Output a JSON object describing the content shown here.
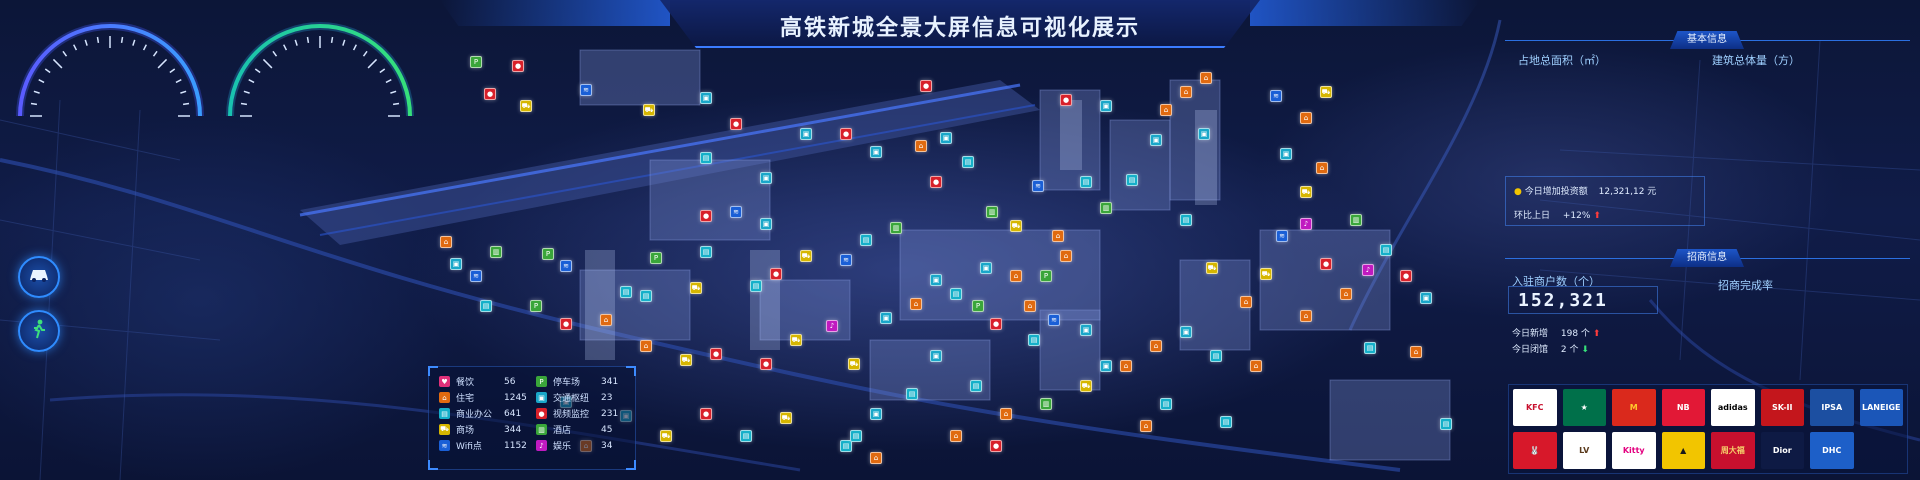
{
  "title": "高铁新城全景大屏信息可视化展示",
  "gauges": [
    {
      "name": "gauge-left",
      "accent": "#5b7bff",
      "accent2": "#3a9dff"
    },
    {
      "name": "gauge-right",
      "accent": "#2bd3a0",
      "accent2": "#22c1e8"
    }
  ],
  "side_buttons": [
    {
      "name": "car-button",
      "icon": "car-icon",
      "glyph": "🚘"
    },
    {
      "name": "walk-button",
      "icon": "walk-icon",
      "glyph": "🏃"
    }
  ],
  "legend": {
    "items": [
      {
        "label": "餐饮",
        "value": "56",
        "color": "#e0307a",
        "icon": "food-icon",
        "glyph": "♥"
      },
      {
        "label": "停车场",
        "value": "341",
        "color": "#3aa63a",
        "icon": "parking-icon",
        "glyph": "P"
      },
      {
        "label": "住宅",
        "value": "1245",
        "color": "#e06a10",
        "icon": "house-icon",
        "glyph": "⌂"
      },
      {
        "label": "交通枢纽",
        "value": "23",
        "color": "#19a7c9",
        "icon": "transit-icon",
        "glyph": "▣"
      },
      {
        "label": "商业办公",
        "value": "641",
        "color": "#15b0c9",
        "icon": "office-icon",
        "glyph": "▤"
      },
      {
        "label": "视频监控",
        "value": "231",
        "color": "#d8202a",
        "icon": "camera-icon",
        "glyph": "●"
      },
      {
        "label": "商场",
        "value": "344",
        "color": "#d6b600",
        "icon": "mall-icon",
        "glyph": "⛟"
      },
      {
        "label": "酒店",
        "value": "45",
        "color": "#3aa63a",
        "icon": "hotel-icon",
        "glyph": "▥"
      },
      {
        "label": "Wifi点",
        "value": "1152",
        "color": "#1a5fd6",
        "icon": "wifi-icon",
        "glyph": "≋"
      },
      {
        "label": "娱乐",
        "value": "34",
        "color": "#c01ac0",
        "icon": "music-icon",
        "glyph": "♪"
      }
    ]
  },
  "basic_info": {
    "heading": "基本信息",
    "area_label": "占地总面积（㎡）",
    "volume_label": "建筑总体量（方）",
    "investment_label": "今日增加投资额",
    "investment_value": "12,321,12 元",
    "change_label": "环比上日",
    "change_value": "+12%"
  },
  "merchant_info": {
    "heading": "招商信息",
    "count_label": "入驻商户数（个）",
    "rate_label": "招商完成率",
    "count_value": "152,321",
    "new_label": "今日新增",
    "new_value": "198 个",
    "closed_label": "今日闭馆",
    "closed_value": "2 个"
  },
  "brands": [
    {
      "label": "KFC",
      "bg": "#ffffff",
      "fg": "#c8102e"
    },
    {
      "label": "★",
      "bg": "#00704a",
      "fg": "#ffffff"
    },
    {
      "label": "M",
      "bg": "#da291c",
      "fg": "#ffc72c"
    },
    {
      "label": "NB",
      "bg": "#e21836",
      "fg": "#ffffff"
    },
    {
      "label": "adidas",
      "bg": "#ffffff",
      "fg": "#000000"
    },
    {
      "label": "SK-II",
      "bg": "#c4161c",
      "fg": "#ffffff"
    },
    {
      "label": "IPSA",
      "bg": "#1c4fa1",
      "fg": "#ffffff"
    },
    {
      "label": "LANEIGE",
      "bg": "#1b56b8",
      "fg": "#ffffff"
    },
    {
      "label": "🐰",
      "bg": "#d7182a",
      "fg": "#ffffff"
    },
    {
      "label": "LV",
      "bg": "#ffffff",
      "fg": "#5a3a1c"
    },
    {
      "label": "Kitty",
      "bg": "#ffffff",
      "fg": "#e3007f"
    },
    {
      "label": "▲",
      "bg": "#f2c500",
      "fg": "#1a1a1a"
    },
    {
      "label": "周大福",
      "bg": "#c8102e",
      "fg": "#f6d36b"
    },
    {
      "label": "Dior",
      "bg": "#0e1a44",
      "fg": "#ffffff"
    },
    {
      "label": "DHC",
      "bg": "#1d5fc8",
      "fg": "#ffffff"
    }
  ]
}
